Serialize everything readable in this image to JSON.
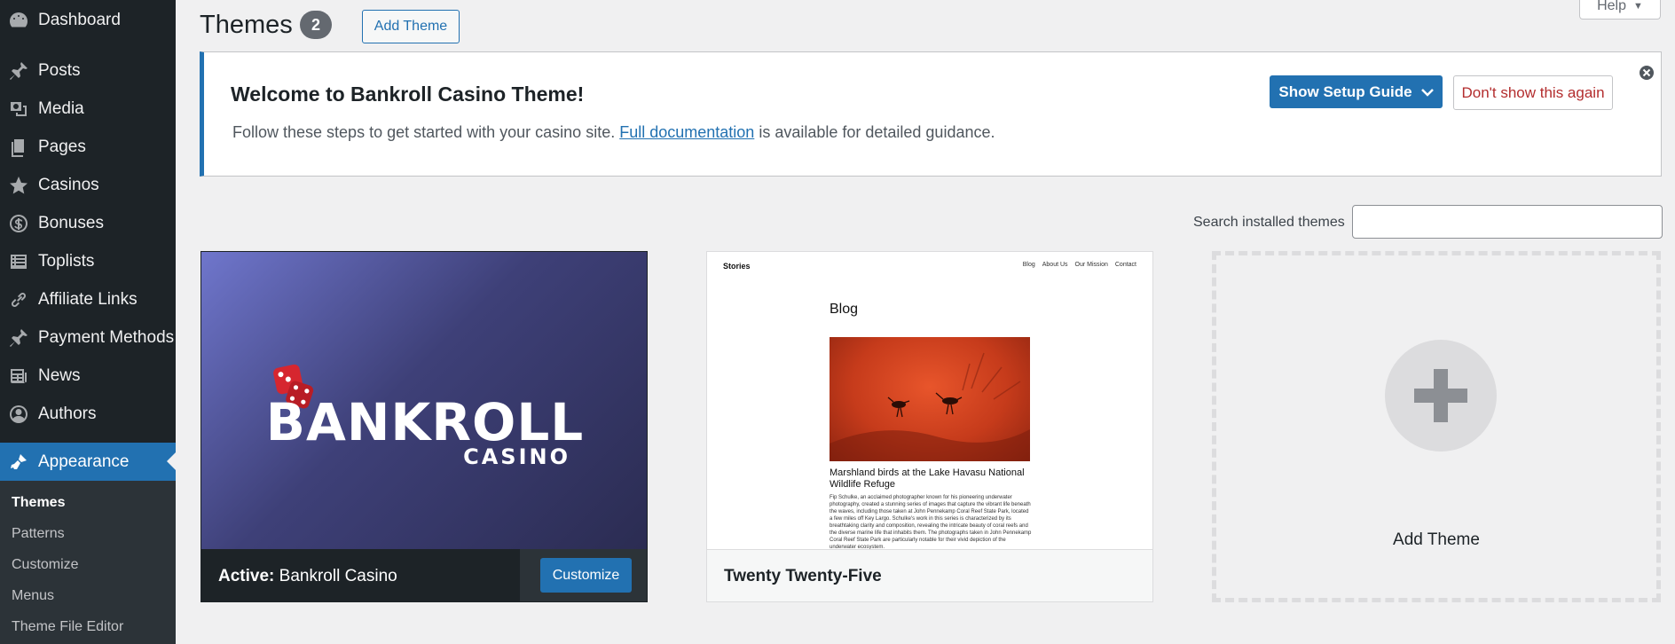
{
  "sidebar": {
    "items": [
      {
        "label": "Dashboard",
        "icon": "dashboard-icon"
      },
      {
        "label": "Posts",
        "icon": "pin-icon"
      },
      {
        "label": "Media",
        "icon": "media-icon"
      },
      {
        "label": "Pages",
        "icon": "pages-icon"
      },
      {
        "label": "Casinos",
        "icon": "star-icon"
      },
      {
        "label": "Bonuses",
        "icon": "dollar-icon"
      },
      {
        "label": "Toplists",
        "icon": "list-icon"
      },
      {
        "label": "Affiliate Links",
        "icon": "link-icon"
      },
      {
        "label": "Payment Methods",
        "icon": "pin-icon"
      },
      {
        "label": "News",
        "icon": "news-icon"
      },
      {
        "label": "Authors",
        "icon": "user-icon"
      },
      {
        "label": "Appearance",
        "icon": "brush-icon"
      }
    ],
    "submenu": [
      "Themes",
      "Patterns",
      "Customize",
      "Menus",
      "Theme File Editor"
    ]
  },
  "header": {
    "title": "Themes",
    "count": "2",
    "add_button": "Add Theme",
    "help": "Help"
  },
  "notice": {
    "title": "Welcome to Bankroll Casino Theme!",
    "text_before": "Follow these steps to get started with your casino site. ",
    "link": "Full documentation",
    "text_after": " is available for detailed guidance.",
    "setup_button": "Show Setup Guide",
    "dismiss_button": "Don't show this again"
  },
  "search": {
    "label": "Search installed themes",
    "value": "",
    "placeholder": ""
  },
  "themes": {
    "active": {
      "prefix": "Active:",
      "name": "Bankroll Casino",
      "customize": "Customize",
      "logo_main": "BANKROLL",
      "logo_sub": "CASINO"
    },
    "second": {
      "name": "Twenty Twenty-Five",
      "preview": {
        "site": "Stories",
        "nav": [
          "Blog",
          "About Us",
          "Our Mission",
          "Contact"
        ],
        "heading": "Blog",
        "headline": "Marshland birds at the Lake Havasu National Wildlife Refuge",
        "body": "Fip Schulke, an acclaimed photographer known for his pioneering underwater photography, created a stunning series of images that capture the vibrant life beneath the waves, including those taken at John Pennekamp Coral Reef State Park, located a few miles off Key Largo. Schulke's work in this series is characterized by its breathtaking clarity and composition, revealing the intricate beauty of coral reefs and the diverse marine life that inhabits them. The photographs taken in John Pennekamp Coral Reef State Park are particularly notable for their vivid depiction of the underwater ecosystem."
      }
    },
    "add_new": "Add Theme"
  },
  "colors": {
    "admin_bar": "#1d2327",
    "accent": "#2271b1",
    "danger": "#b32d2e"
  }
}
